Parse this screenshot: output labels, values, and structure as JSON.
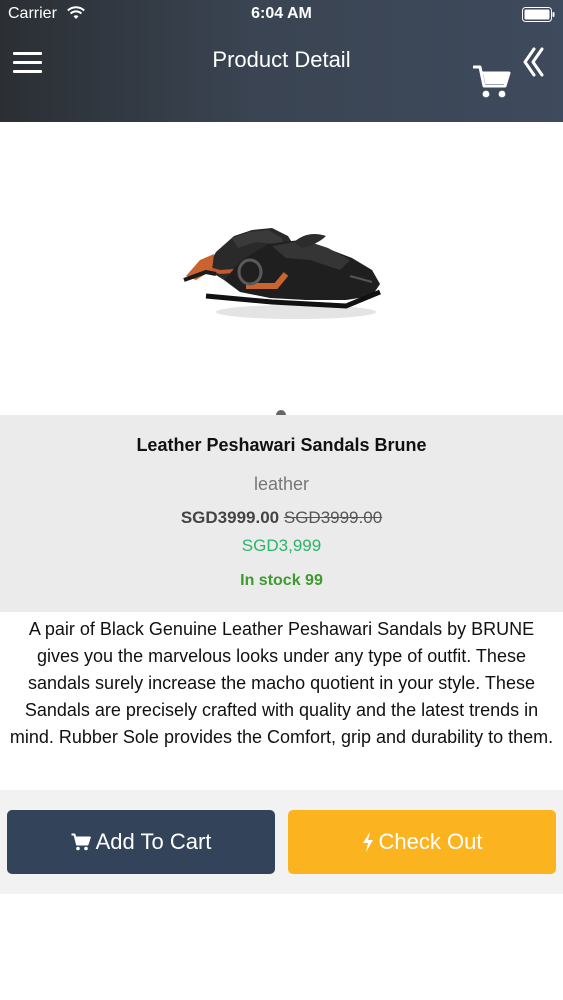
{
  "status_bar": {
    "carrier": "Carrier",
    "time": "6:04 AM"
  },
  "header": {
    "title": "Product Detail",
    "icons": [
      "menu-icon",
      "cart-icon",
      "back-chevron-icon"
    ],
    "gradient_colors": [
      "#2b2f34",
      "#3e4a5d"
    ]
  },
  "product": {
    "name": "Leather Peshawari Sandals Brune",
    "material": "leather",
    "price": "SGD3999.00",
    "original_price": "SGD3999.00",
    "discount_price": "SGD3,999",
    "stock": "In stock 99",
    "description": "A pair of Black Genuine Leather Peshawari Sandals by BRUNE gives you the marvelous looks under any type of outfit. These sandals surely increase the macho quotient in your style. These Sandals are precisely crafted with quality and the latest trends in mind. Rubber Sole provides the Comfort, grip and durability to them."
  },
  "actions": {
    "add_to_cart": "Add To Cart",
    "check_out": "Check Out",
    "add_to_cart_color": "#33435a",
    "check_out_color": "#fbb41f"
  },
  "colors": {
    "in_stock": "#3e9a2e",
    "discount": "#2bb56b",
    "info_background": "#ebebeb"
  }
}
